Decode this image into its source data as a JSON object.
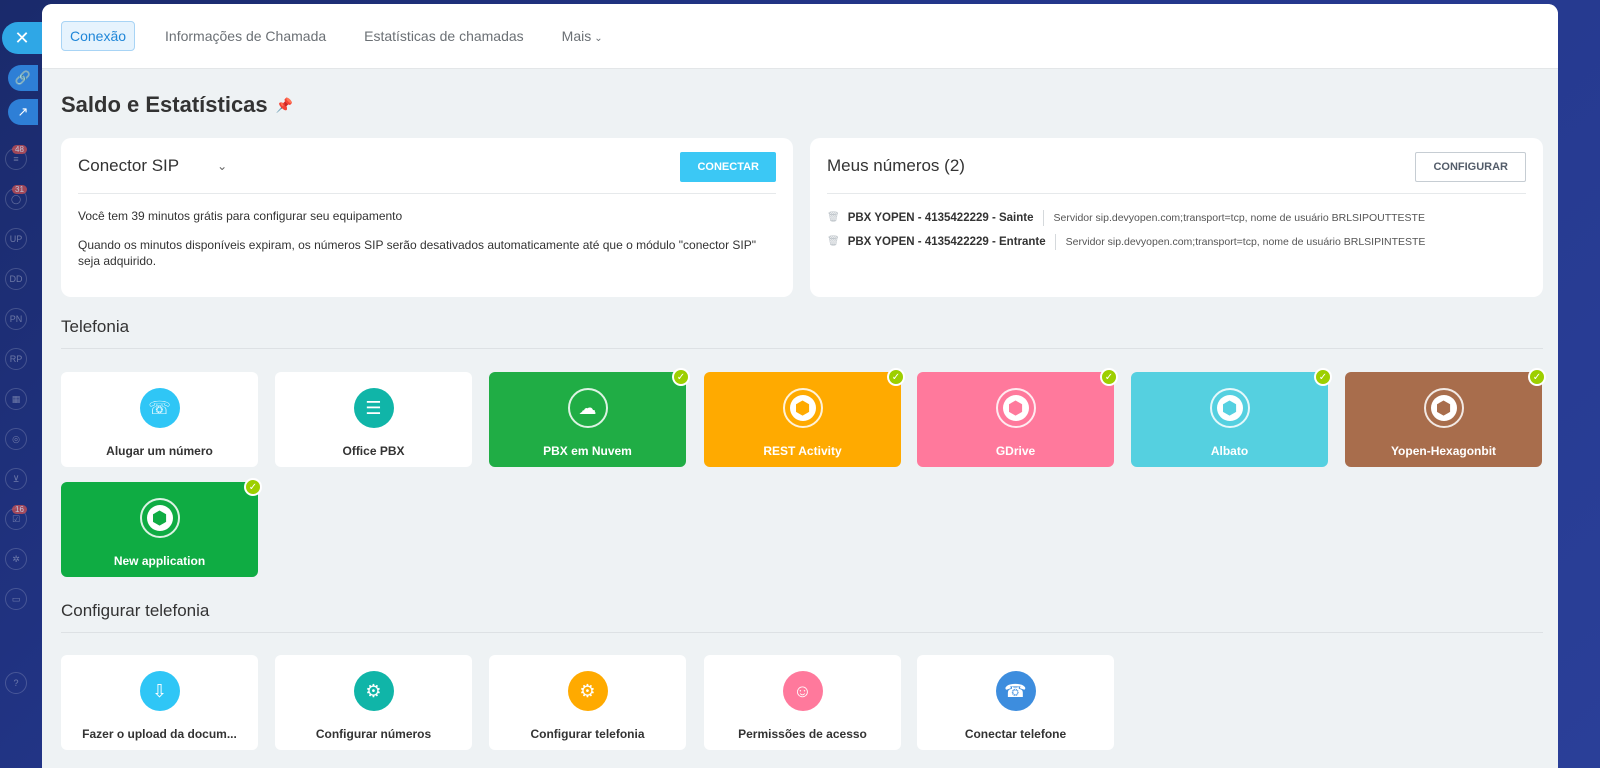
{
  "rail": {
    "close_icon": "close-icon",
    "badges": [
      "48",
      "31",
      "16"
    ],
    "avatars": [
      "UP",
      "DD",
      "PN",
      "RP"
    ]
  },
  "tabs": [
    {
      "label": "Conexão",
      "active": true
    },
    {
      "label": "Informações de Chamada",
      "active": false
    },
    {
      "label": "Estatísticas de chamadas",
      "active": false
    },
    {
      "label": "Mais",
      "active": false
    }
  ],
  "page_title": "Saldo e Estatísticas",
  "sip_card": {
    "title": "Conector SIP",
    "button": "CONECTAR",
    "line1": "Você tem 39 minutos grátis para configurar seu equipamento",
    "line2": "Quando os minutos disponíveis expiram, os números SIP serão desativados automaticamente até que o módulo \"conector SIP\" seja adquirido."
  },
  "numbers_card": {
    "title": "Meus números (2)",
    "button": "CONFIGURAR",
    "items": [
      {
        "name": "PBX YOPEN - 4135422229 - Sainte",
        "server": "Servidor sip.devyopen.com;transport=tcp, nome de usuário BRLSIPOUTTESTE"
      },
      {
        "name": "PBX YOPEN - 4135422229 - Entrante",
        "server": "Servidor sip.devyopen.com;transport=tcp, nome de usuário BRLSIPINTESTE"
      }
    ]
  },
  "telefonia": {
    "title": "Telefonia",
    "tiles": [
      {
        "label": "Alugar um número",
        "icon": "phone-dollar-icon",
        "color": "#2fc6f6"
      },
      {
        "label": "Office PBX",
        "icon": "pbx-icon",
        "color": "#10b5a8"
      },
      {
        "label": "PBX em Nuvem",
        "icon": "cloud-pbx-icon",
        "color": "#20ad45",
        "installed": true
      },
      {
        "label": "REST Activity",
        "icon": "box-icon",
        "color": "#ffaa00",
        "installed": true
      },
      {
        "label": "GDrive",
        "icon": "box-icon",
        "color": "#ff799c",
        "installed": true
      },
      {
        "label": "Albato",
        "icon": "box-icon",
        "color": "#55d0e0",
        "installed": true
      },
      {
        "label": "Yopen-Hexagonbit",
        "icon": "box-icon",
        "color": "#a86d4c",
        "installed": true
      },
      {
        "label": "New application",
        "icon": "box-icon",
        "color": "#0fac43",
        "installed": true
      }
    ]
  },
  "config": {
    "title": "Configurar telefonia",
    "tiles": [
      {
        "label": "Fazer o upload da docum...",
        "icon": "upload-document-icon",
        "color": "#2fc6f6"
      },
      {
        "label": "Configurar números",
        "icon": "numbers-settings-icon",
        "color": "#10b5a8"
      },
      {
        "label": "Configurar telefonia",
        "icon": "telephony-settings-icon",
        "color": "#ffaa00"
      },
      {
        "label": "Permissões de acesso",
        "icon": "access-permissions-icon",
        "color": "#ff799c"
      },
      {
        "label": "Conectar telefone",
        "icon": "connect-phone-icon",
        "color": "#3d8dde"
      }
    ]
  }
}
